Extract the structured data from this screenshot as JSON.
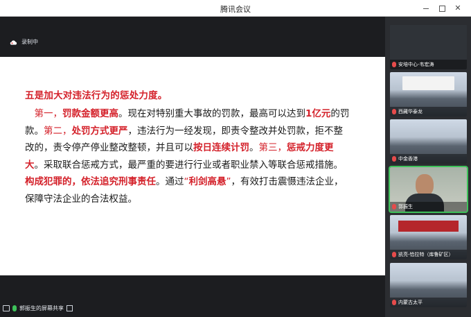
{
  "window": {
    "title": "腾讯会议"
  },
  "recording": {
    "label": "录制中"
  },
  "slide": {
    "heading": "五是加大对违法行为的惩处力度。",
    "segments": [
      {
        "text": "　第一，",
        "style": "red"
      },
      {
        "text": "罚款金额更高",
        "style": "redb"
      },
      {
        "text": "。现在对特别重大事故的罚款，最高可以达到",
        "style": ""
      },
      {
        "text": "1亿元",
        "style": "redb"
      },
      {
        "text": "的罚款。",
        "style": ""
      },
      {
        "text": "第二，",
        "style": "red"
      },
      {
        "text": "处罚方式更严",
        "style": "redb"
      },
      {
        "text": "，违法行为一经发现，即责令整改并处罚款，拒不整改的，责令停产停业整改整顿，并且可以",
        "style": ""
      },
      {
        "text": "按日连续计罚",
        "style": "redb"
      },
      {
        "text": "。",
        "style": ""
      },
      {
        "text": "第三，",
        "style": "red"
      },
      {
        "text": "惩戒力度更大",
        "style": "redb"
      },
      {
        "text": "。采取联合惩戒方式，最严重的要进行行业或者职业禁入等联合惩戒措施。",
        "style": ""
      },
      {
        "text": "构成犯罪的，依法追究刑事责任",
        "style": "redb"
      },
      {
        "text": "。通过",
        "style": ""
      },
      {
        "text": "“",
        "style": "red"
      },
      {
        "text": "利剑高悬",
        "style": "redb"
      },
      {
        "text": "”",
        "style": "red"
      },
      {
        "text": "，有效打击震慑违法企业，保障守法企业的合法权益。",
        "style": ""
      }
    ]
  },
  "participants": [
    {
      "name": "安培中心-韦宏涛",
      "scene": "dark",
      "active": false
    },
    {
      "name": "西藏华泰龙",
      "scene": "room-banner",
      "active": false
    },
    {
      "name": "中金香港",
      "scene": "room",
      "active": false
    },
    {
      "name": "郭振生",
      "scene": "person",
      "active": true
    },
    {
      "name": "凯亮-恰拉特（库鲁矿区）",
      "scene": "room-red",
      "active": false
    },
    {
      "name": "内蒙古太平",
      "scene": "room",
      "active": false
    }
  ],
  "bottombar": {
    "share_label": "郭振生的屏幕共享"
  },
  "colors": {
    "accent_red": "#d4212a",
    "mic_green": "#3ec25a"
  }
}
